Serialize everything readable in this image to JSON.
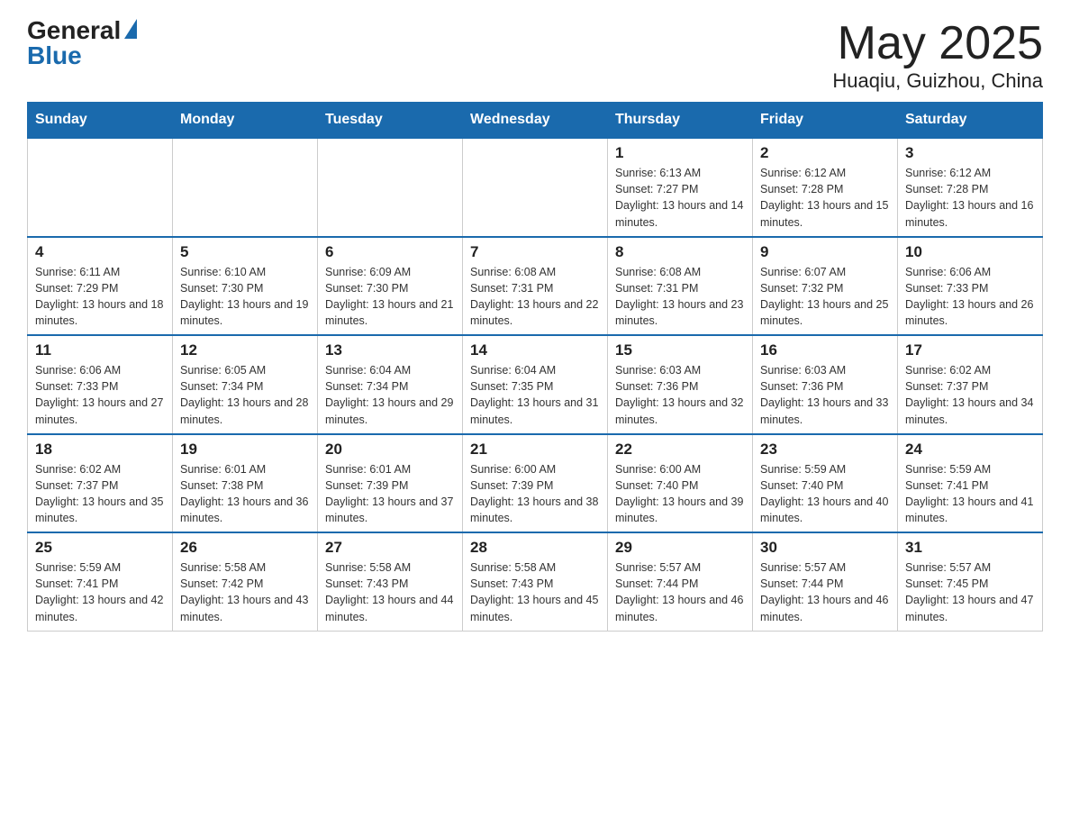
{
  "header": {
    "logo_general": "General",
    "logo_blue": "Blue",
    "title": "May 2025",
    "location": "Huaqiu, Guizhou, China"
  },
  "weekdays": [
    "Sunday",
    "Monday",
    "Tuesday",
    "Wednesday",
    "Thursday",
    "Friday",
    "Saturday"
  ],
  "weeks": [
    [
      {
        "day": "",
        "info": ""
      },
      {
        "day": "",
        "info": ""
      },
      {
        "day": "",
        "info": ""
      },
      {
        "day": "",
        "info": ""
      },
      {
        "day": "1",
        "info": "Sunrise: 6:13 AM\nSunset: 7:27 PM\nDaylight: 13 hours and 14 minutes."
      },
      {
        "day": "2",
        "info": "Sunrise: 6:12 AM\nSunset: 7:28 PM\nDaylight: 13 hours and 15 minutes."
      },
      {
        "day": "3",
        "info": "Sunrise: 6:12 AM\nSunset: 7:28 PM\nDaylight: 13 hours and 16 minutes."
      }
    ],
    [
      {
        "day": "4",
        "info": "Sunrise: 6:11 AM\nSunset: 7:29 PM\nDaylight: 13 hours and 18 minutes."
      },
      {
        "day": "5",
        "info": "Sunrise: 6:10 AM\nSunset: 7:30 PM\nDaylight: 13 hours and 19 minutes."
      },
      {
        "day": "6",
        "info": "Sunrise: 6:09 AM\nSunset: 7:30 PM\nDaylight: 13 hours and 21 minutes."
      },
      {
        "day": "7",
        "info": "Sunrise: 6:08 AM\nSunset: 7:31 PM\nDaylight: 13 hours and 22 minutes."
      },
      {
        "day": "8",
        "info": "Sunrise: 6:08 AM\nSunset: 7:31 PM\nDaylight: 13 hours and 23 minutes."
      },
      {
        "day": "9",
        "info": "Sunrise: 6:07 AM\nSunset: 7:32 PM\nDaylight: 13 hours and 25 minutes."
      },
      {
        "day": "10",
        "info": "Sunrise: 6:06 AM\nSunset: 7:33 PM\nDaylight: 13 hours and 26 minutes."
      }
    ],
    [
      {
        "day": "11",
        "info": "Sunrise: 6:06 AM\nSunset: 7:33 PM\nDaylight: 13 hours and 27 minutes."
      },
      {
        "day": "12",
        "info": "Sunrise: 6:05 AM\nSunset: 7:34 PM\nDaylight: 13 hours and 28 minutes."
      },
      {
        "day": "13",
        "info": "Sunrise: 6:04 AM\nSunset: 7:34 PM\nDaylight: 13 hours and 29 minutes."
      },
      {
        "day": "14",
        "info": "Sunrise: 6:04 AM\nSunset: 7:35 PM\nDaylight: 13 hours and 31 minutes."
      },
      {
        "day": "15",
        "info": "Sunrise: 6:03 AM\nSunset: 7:36 PM\nDaylight: 13 hours and 32 minutes."
      },
      {
        "day": "16",
        "info": "Sunrise: 6:03 AM\nSunset: 7:36 PM\nDaylight: 13 hours and 33 minutes."
      },
      {
        "day": "17",
        "info": "Sunrise: 6:02 AM\nSunset: 7:37 PM\nDaylight: 13 hours and 34 minutes."
      }
    ],
    [
      {
        "day": "18",
        "info": "Sunrise: 6:02 AM\nSunset: 7:37 PM\nDaylight: 13 hours and 35 minutes."
      },
      {
        "day": "19",
        "info": "Sunrise: 6:01 AM\nSunset: 7:38 PM\nDaylight: 13 hours and 36 minutes."
      },
      {
        "day": "20",
        "info": "Sunrise: 6:01 AM\nSunset: 7:39 PM\nDaylight: 13 hours and 37 minutes."
      },
      {
        "day": "21",
        "info": "Sunrise: 6:00 AM\nSunset: 7:39 PM\nDaylight: 13 hours and 38 minutes."
      },
      {
        "day": "22",
        "info": "Sunrise: 6:00 AM\nSunset: 7:40 PM\nDaylight: 13 hours and 39 minutes."
      },
      {
        "day": "23",
        "info": "Sunrise: 5:59 AM\nSunset: 7:40 PM\nDaylight: 13 hours and 40 minutes."
      },
      {
        "day": "24",
        "info": "Sunrise: 5:59 AM\nSunset: 7:41 PM\nDaylight: 13 hours and 41 minutes."
      }
    ],
    [
      {
        "day": "25",
        "info": "Sunrise: 5:59 AM\nSunset: 7:41 PM\nDaylight: 13 hours and 42 minutes."
      },
      {
        "day": "26",
        "info": "Sunrise: 5:58 AM\nSunset: 7:42 PM\nDaylight: 13 hours and 43 minutes."
      },
      {
        "day": "27",
        "info": "Sunrise: 5:58 AM\nSunset: 7:43 PM\nDaylight: 13 hours and 44 minutes."
      },
      {
        "day": "28",
        "info": "Sunrise: 5:58 AM\nSunset: 7:43 PM\nDaylight: 13 hours and 45 minutes."
      },
      {
        "day": "29",
        "info": "Sunrise: 5:57 AM\nSunset: 7:44 PM\nDaylight: 13 hours and 46 minutes."
      },
      {
        "day": "30",
        "info": "Sunrise: 5:57 AM\nSunset: 7:44 PM\nDaylight: 13 hours and 46 minutes."
      },
      {
        "day": "31",
        "info": "Sunrise: 5:57 AM\nSunset: 7:45 PM\nDaylight: 13 hours and 47 minutes."
      }
    ]
  ]
}
